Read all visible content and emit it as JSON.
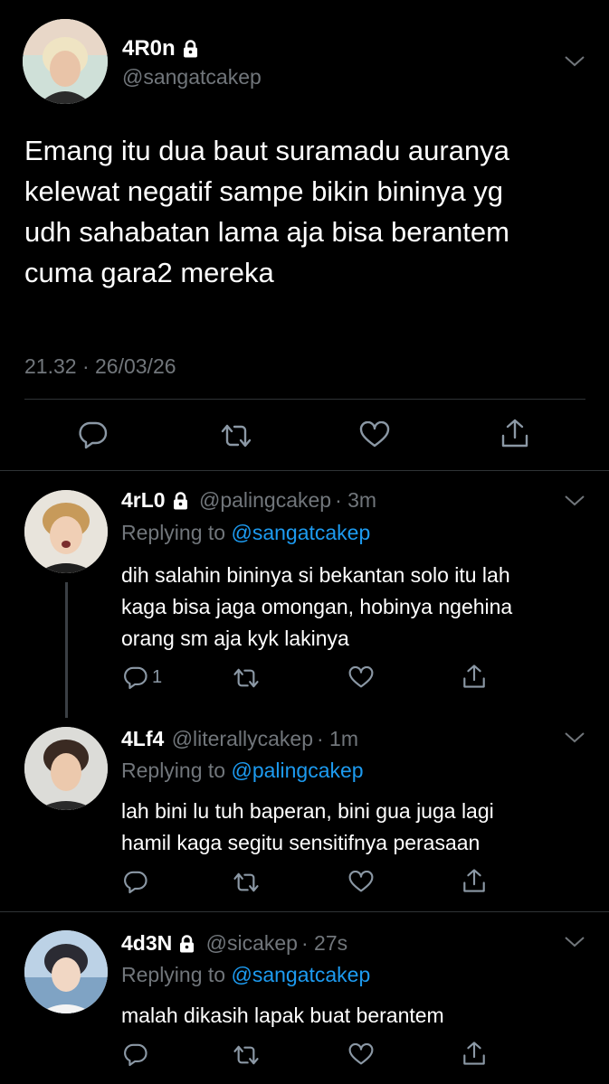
{
  "main_tweet": {
    "display_name": "4R0n",
    "handle": "@sangatcakep",
    "text_lines": [
      "Emang itu dua baut suramadu auranya",
      "kelewat negatif sampe bikin bininya yg",
      "udh sahabatan lama aja bisa berantem",
      "cuma gara2 mereka"
    ],
    "timestamp": "21.32 · 26/03/26",
    "protected": true
  },
  "replies": [
    {
      "display_name": "4rL0",
      "handle": "@palingcakep",
      "time": "· 3m",
      "replying_prefix": "Replying to",
      "replying_to": "@sangatcakep",
      "text_lines": [
        "dih salahin bininya si bekantan solo itu lah",
        "kaga bisa jaga omongan, hobinya ngehina",
        "orang sm aja kyk lakinya"
      ],
      "reply_count": "1",
      "protected": true
    },
    {
      "display_name": "4Lf4",
      "handle": "@literallycakep",
      "time": "· 1m",
      "replying_prefix": "Replying to",
      "replying_to": "@palingcakep",
      "text_lines": [
        "lah bini lu tuh baperan, bini gua juga lagi",
        "hamil kaga segitu sensitifnya perasaan"
      ],
      "reply_count": "",
      "protected": false
    },
    {
      "display_name": "4d3N",
      "handle": "@sicakep",
      "time": "· 27s",
      "replying_prefix": "Replying to",
      "replying_to": "@sangatcakep",
      "text_lines": [
        "malah dikasih lapak buat berantem"
      ],
      "reply_count": "",
      "protected": true
    }
  ],
  "icons": {
    "reply": "reply-icon",
    "retweet": "retweet-icon",
    "like": "heart-icon",
    "share": "share-icon",
    "more": "chevron-down-icon",
    "protected": "lock-icon"
  },
  "colors": {
    "background": "#000000",
    "text": "#e7e9ea",
    "muted": "#71767b",
    "link": "#1d9bf0",
    "divider": "#2f3336"
  }
}
